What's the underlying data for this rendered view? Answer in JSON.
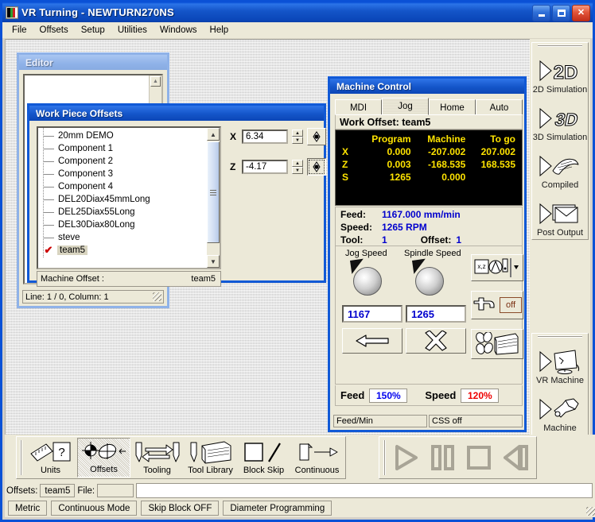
{
  "window": {
    "title": "VR Turning - NEWTURN270NS",
    "icon": "app-icon",
    "controls": {
      "minimize": "minimize",
      "maximize": "maximize",
      "close": "close"
    }
  },
  "menu": {
    "items": [
      "File",
      "Offsets",
      "Setup",
      "Utilities",
      "Windows",
      "Help"
    ]
  },
  "editor": {
    "title": "Editor",
    "status": "Line: 1 / 0, Column: 1",
    "content": ""
  },
  "work_piece_offsets": {
    "title": "Work Piece Offsets",
    "items": [
      "20mm DEMO",
      "Component 1",
      "Component 2",
      "Component 3",
      "Component 4",
      "DEL20Diax45mmLong",
      "DEL25Diax55Long",
      "DEL30Diax80Long",
      "steve",
      "team5"
    ],
    "selected": "team5",
    "checked_index": 9,
    "x_label": "X",
    "x_value": "6.34",
    "z_label": "Z",
    "z_value": "-4.17",
    "footer_label": "Machine Offset :",
    "footer_value": "team5",
    "x_target_button": "set-x-datum",
    "z_target_button": "set-z-datum"
  },
  "machine_control": {
    "title": "Machine Control",
    "tabs": [
      "MDI",
      "Jog",
      "Home",
      "Auto"
    ],
    "active_tab": "Jog",
    "work_offset_label": "Work Offset: team5",
    "dro": {
      "headers": [
        "",
        "Program",
        "Machine",
        "To go"
      ],
      "rows": [
        {
          "axis": "X",
          "program": "0.000",
          "machine": "-207.002",
          "togo": "207.002"
        },
        {
          "axis": "Z",
          "program": "0.003",
          "machine": "-168.535",
          "togo": "168.535"
        },
        {
          "axis": "S",
          "program": "1265",
          "machine": "0.000",
          "togo": ""
        }
      ],
      "text_color": "#ffe400",
      "background": "#000000"
    },
    "feed_label": "Feed:",
    "feed_value": "1167.000 mm/min",
    "speed_label": "Speed:",
    "speed_value": "1265 RPM",
    "tool_label": "Tool:",
    "tool_value": "1",
    "offset_label": "Offset:",
    "offset_value": "1",
    "jog_speed_label": "Jog Speed",
    "spindle_speed_label": "Spindle Speed",
    "jog_speed_value": "1167",
    "spindle_speed_value": "1265",
    "jog_back_button": "jog-negative",
    "spindle_stop_button": "spindle-stop",
    "axis_select_button": "axis-select-xz",
    "coolant_button": "coolant-toggle",
    "coolant_state": "off",
    "tooling_button": "tooling",
    "feed_override_label": "Feed",
    "feed_override_value": "150%",
    "feed_override_color": "#0000ee",
    "speed_override_label": "Speed",
    "speed_override_value": "120%",
    "speed_override_color": "#ee0000",
    "status_left": "Feed/Min",
    "status_right": "CSS off"
  },
  "right_rail": {
    "group_top": [
      {
        "label": "2D Simulation",
        "icon": "play-2d-icon"
      },
      {
        "label": "3D Simulation",
        "icon": "play-3d-icon"
      },
      {
        "label": "Compiled",
        "icon": "play-compiled-icon"
      },
      {
        "label": "Post Output",
        "icon": "play-post-output-icon"
      }
    ],
    "group_bottom": [
      {
        "label": "VR Machine",
        "icon": "play-vr-machine-icon"
      },
      {
        "label": "Machine",
        "icon": "play-machine-icon"
      }
    ]
  },
  "bottom_toolbar": {
    "buttons": [
      {
        "label": "Units",
        "icon": "units-icon",
        "active": false
      },
      {
        "label": "Offsets",
        "icon": "offsets-icon",
        "active": true
      },
      {
        "label": "Tooling",
        "icon": "tooling-icon",
        "active": false
      },
      {
        "label": "Tool Library",
        "icon": "tool-library-icon",
        "active": false
      },
      {
        "label": "Block Skip",
        "icon": "block-skip-icon",
        "active": false
      },
      {
        "label": "Continuous",
        "icon": "continuous-icon",
        "active": false
      }
    ],
    "transport": [
      {
        "name": "play-button",
        "icon": "play-icon"
      },
      {
        "name": "pause-button",
        "icon": "pause-icon"
      },
      {
        "name": "stop-button",
        "icon": "stop-icon"
      },
      {
        "name": "rewind-button",
        "icon": "rewind-icon"
      }
    ]
  },
  "status_bar_1": {
    "offsets_label": "Offsets:",
    "offsets_value": "team5",
    "file_label": "File:",
    "file_value": ""
  },
  "status_bar_2": {
    "cells": [
      "Metric",
      "Continuous Mode",
      "Skip Block OFF",
      "Diameter Programming"
    ]
  }
}
